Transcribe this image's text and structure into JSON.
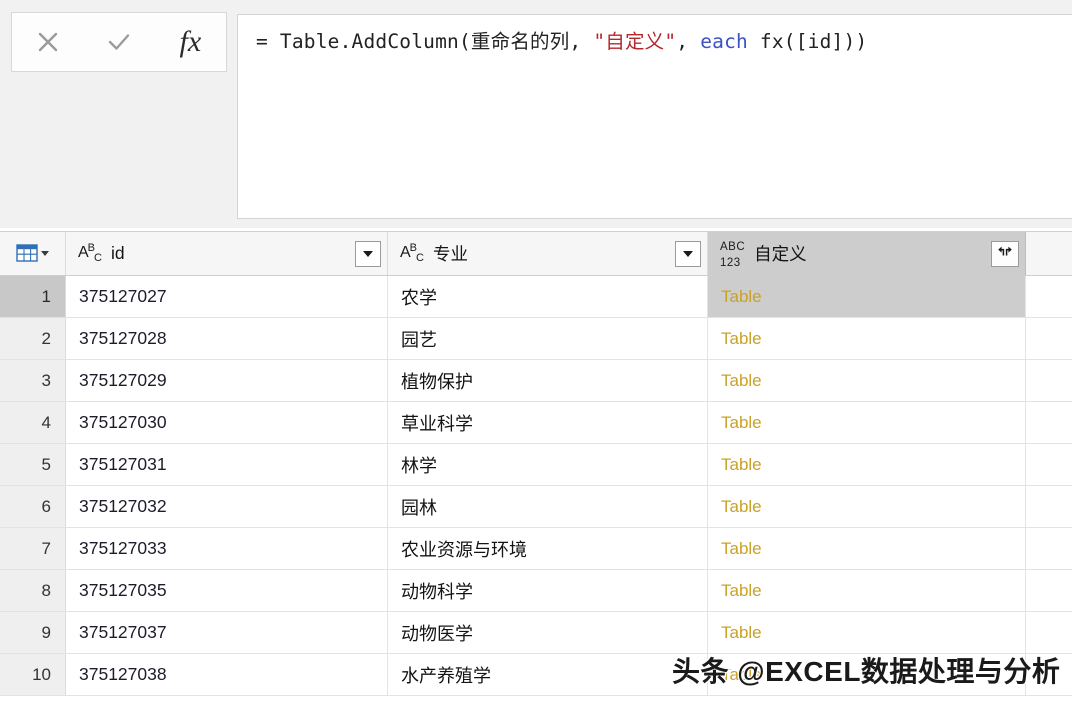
{
  "formula_bar": {
    "cancel_icon": "close-icon",
    "accept_icon": "check-icon",
    "fx_label": "fx",
    "formula_prefix": "= Table.AddColumn(重命名的列, ",
    "formula_string": "\"自定义\"",
    "formula_middle": ", ",
    "formula_keyword": "each",
    "formula_suffix": " fx([id]))",
    "string_color": "#b4282e",
    "keyword_color": "#3b51c4"
  },
  "grid": {
    "corner_icon": "table-select-icon",
    "columns": [
      {
        "key": "rownum",
        "label": "",
        "type_icon": "",
        "has_filter": false,
        "selected": false
      },
      {
        "key": "id",
        "label": "id",
        "type_icon": "abc-text-type-icon",
        "has_filter": true,
        "selected": false
      },
      {
        "key": "major",
        "label": "专业",
        "type_icon": "abc-text-type-icon",
        "has_filter": true,
        "selected": false
      },
      {
        "key": "custom",
        "label": "自定义",
        "type_icon": "abc123-any-type-icon",
        "has_filter": false,
        "has_expand": true,
        "expand_icon": "expand-columns-icon",
        "selected": true
      }
    ],
    "rows": [
      {
        "num": "1",
        "id": "375127027",
        "major": "农学",
        "custom": "Table",
        "selected": true
      },
      {
        "num": "2",
        "id": "375127028",
        "major": "园艺",
        "custom": "Table",
        "selected": false
      },
      {
        "num": "3",
        "id": "375127029",
        "major": "植物保护",
        "custom": "Table",
        "selected": false
      },
      {
        "num": "4",
        "id": "375127030",
        "major": "草业科学",
        "custom": "Table",
        "selected": false
      },
      {
        "num": "5",
        "id": "375127031",
        "major": "林学",
        "custom": "Table",
        "selected": false
      },
      {
        "num": "6",
        "id": "375127032",
        "major": "园林",
        "custom": "Table",
        "selected": false
      },
      {
        "num": "7",
        "id": "375127033",
        "major": "农业资源与环境",
        "custom": "Table",
        "selected": false
      },
      {
        "num": "8",
        "id": "375127035",
        "major": "动物科学",
        "custom": "Table",
        "selected": false
      },
      {
        "num": "9",
        "id": "375127037",
        "major": "动物医学",
        "custom": "Table",
        "selected": false
      },
      {
        "num": "10",
        "id": "375127038",
        "major": "水产养殖学",
        "custom": "Table",
        "selected": false
      }
    ],
    "link_color": "#c9a227",
    "selection_color": "#cdcdcd"
  },
  "watermark": {
    "text": "头条 @EXCEL数据处理与分析"
  }
}
